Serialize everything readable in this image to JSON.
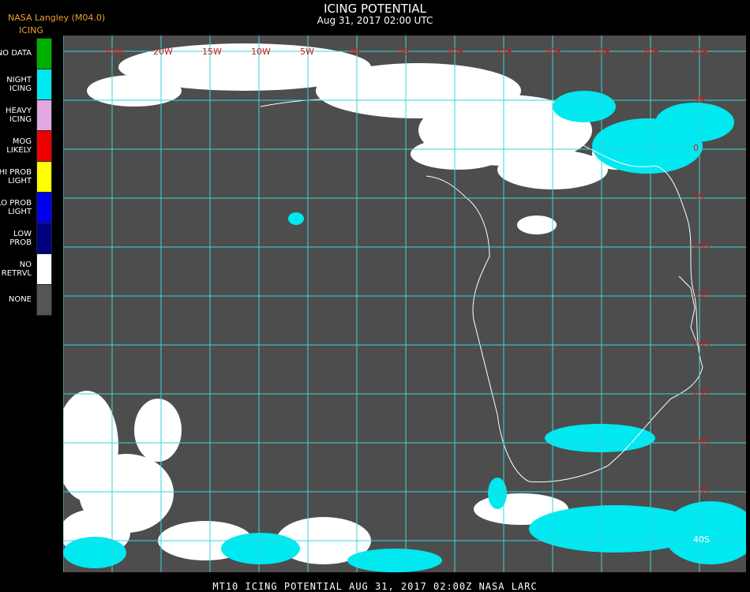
{
  "header": {
    "title": "ICING POTENTIAL",
    "subtitle": "Aug 31, 2017 02:00 UTC"
  },
  "brand": {
    "source": "NASA Langley (M04.0)",
    "product": "ICING"
  },
  "legend": [
    {
      "label": "NO DATA",
      "color": "#00b000"
    },
    {
      "label": "NIGHT\nICING",
      "color": "#00e8f0"
    },
    {
      "label": "HEAVY\nICING",
      "color": "#e0a8e0"
    },
    {
      "label": "MOG\nLIKELY",
      "color": "#ee0000"
    },
    {
      "label": "HI PROB\nLIGHT",
      "color": "#ffff00"
    },
    {
      "label": "LO PROB\nLIGHT",
      "color": "#0000ee"
    },
    {
      "label": "LOW\nPROB",
      "color": "#000080"
    },
    {
      "label": "NO\nRETRVL",
      "color": "#ffffff"
    },
    {
      "label": "NONE",
      "color": "#555555"
    }
  ],
  "map": {
    "background": "#4d4d4d",
    "grid_color": "#3ad6dc",
    "label_color": "#cc1a1a",
    "lon_labels": [
      "25W",
      "20W",
      "15W",
      "10W",
      "5W",
      "0E",
      "5E",
      "10E",
      "15E",
      "20E",
      "25E",
      "30E",
      "35E"
    ],
    "lat_labels": [
      "5N",
      "0",
      "5S",
      "10S",
      "15S",
      "20S",
      "25S",
      "30S",
      "35S",
      "40S"
    ]
  },
  "footer": {
    "text": "MT10  ICING POTENTIAL   AUG 31, 2017 02:00Z   NASA LARC"
  }
}
